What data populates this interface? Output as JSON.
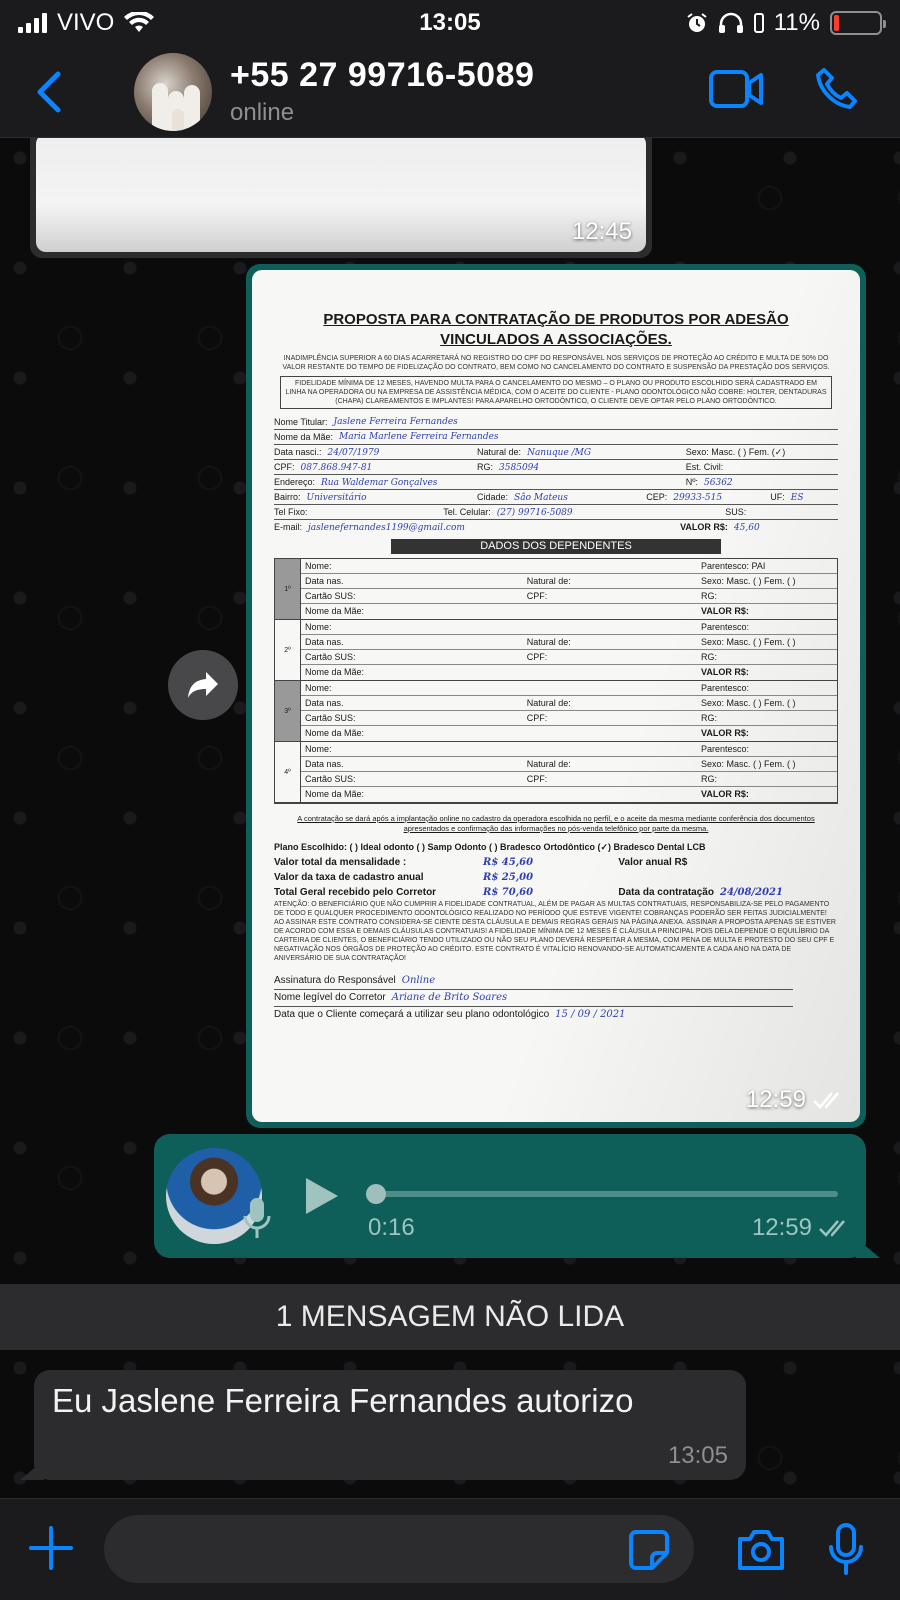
{
  "status_bar": {
    "carrier": "VIVO",
    "time": "13:05",
    "battery_percent": "11%",
    "battery_level": 0.11
  },
  "header": {
    "contact_name": "+55 27 99716-5089",
    "contact_status": "online",
    "icons": {
      "back": "chevron-left-icon",
      "video": "video-camera-icon",
      "call": "phone-icon"
    },
    "accent_color": "#0a84ff"
  },
  "messages": [
    {
      "type": "image",
      "direction": "in",
      "time": "12:45"
    },
    {
      "type": "image",
      "direction": "out",
      "time": "12:59",
      "ticks": "read",
      "document": {
        "title": "PROPOSTA PARA CONTRATAÇÃO DE PRODUTOS POR ADESÃO VINCULADOS A ASSOCIAÇÕES.",
        "notice": "INADIMPLÊNCIA SUPERIOR A 60 DIAS ACARRETARÁ NO REGISTRO DO CPF DO RESPONSÁVEL NOS SERVIÇOS DE PROTEÇÃO AO CRÉDITO E MULTA DE 50% DO VALOR RESTANTE DO TEMPO DE FIDELIZAÇÃO DO CONTRATO, BEM COMO NO CANCELAMENTO DO CONTRATO E SUSPENSÃO DA PRESTAÇÃO DOS SERVIÇOS.",
        "box_text": "FIDELIDADE MÍNIMA DE 12 MESES, HAVENDO MULTA PARA O CANCELAMENTO DO MESMO – O PLANO OU PRODUTO ESCOLHIDO SERÁ CADASTRADO EM LINHA NA OPERADORA OU NA EMPRESA DE ASSISTÊNCIA MÉDICA, COM O ACEITE DO CLIENTE - PLANO ODONTOLÓGICO NÃO COBRE: HOLTER, DENTADURAS (CHAPA) CLAREAMENTOS E IMPLANTES! PARA APARELHO ORTODÔNTICO, O CLIENTE DEVE OPTAR PELO PLANO ORTODÔNTICO.",
        "titular": [
          {
            "label": "Nome Titular:",
            "value": "Jaslene Ferreira Fernandes"
          },
          {
            "label": "Nome da Mãe:",
            "value": "Maria Marlene Ferreira Fernandes"
          },
          {
            "label": "Data nasci.:",
            "value": "24/07/1979",
            "label2": "Natural de:",
            "value2": "Nanuque /MG",
            "label3": "Sexo: Masc. (  ) Fem. (✓)"
          },
          {
            "label": "CPF:",
            "value": "087.868.947-81",
            "label2": "RG:",
            "value2": "3585094",
            "label3": "Est. Civil:"
          },
          {
            "label": "Endereço:",
            "value": "Rua Waldemar Gonçalves",
            "label3": "Nº:",
            "value3": "56362"
          },
          {
            "label": "Bairro:",
            "value": "Universitário",
            "label2": "Cidade:",
            "value2": "São Mateus",
            "label3": "CEP:",
            "value3": "29933-515",
            "label4": "UF:",
            "value4": "ES"
          },
          {
            "label": "Tel Fixo:",
            "label2": "Tel. Celular:",
            "value2": "(27) 99716-5089",
            "label3": "SUS:"
          },
          {
            "label": "E-mail:",
            "value": "jaslenefernandes1199@gmail.com",
            "label3": "VALOR R$:",
            "value3": "45,60"
          }
        ],
        "dependents_header": "DADOS DOS DEPENDENTES",
        "dependents": [
          {
            "num": "1º",
            "parentesco": "Parentesco: PAI"
          },
          {
            "num": "2º",
            "parentesco": "Parentesco:"
          },
          {
            "num": "3º",
            "parentesco": "Parentesco:"
          },
          {
            "num": "4º",
            "parentesco": "Parentesco:"
          }
        ],
        "dep_labels": {
          "nome": "Nome:",
          "data": "Data nas.",
          "natural": "Natural de:",
          "sexo": "Sexo: Masc. (  ) Fem. (  )",
          "cartao": "Cartão SUS:",
          "cpf": "CPF:",
          "rg": "RG:",
          "mae": "Nome da Mãe:",
          "valor": "VALOR R$:"
        },
        "note": "A contratação se dará após a implantação online no cadastro da operadora escolhida no perfil, e o aceite da mesma mediante conferência dos documentos apresentados e confirmação das informações no pós-venda telefônico por parte da mesma.",
        "plano": "Plano Escolhido: ( ) Ideal odonto ( ) Samp Odonto ( ) Bradesco Ortodôntico (✓) Bradesco Dental LCB",
        "valor_total_label": "Valor total da mensalidade :",
        "valor_total": "R$ 45,60",
        "valor_anual_label": "Valor anual R$",
        "taxa_label": "Valor da taxa de cadastro anual",
        "taxa": "R$ 25,00",
        "total_geral_label": "Total Geral recebido pelo Corretor",
        "total_geral": "R$ 70,60",
        "data_contratacao_label": "Data da contratação",
        "data_contratacao": "24/08/2021",
        "atencao": "ATENÇÃO: O BENEFICIÁRIO QUE NÃO CUMPRIR A FIDELIDADE CONTRATUAL, ALÉM DE PAGAR AS MULTAS CONTRATUAIS, RESPONSABILIZA-SE PELO PAGAMENTO DE TODO E QUALQUER PROCEDIMENTO ODONTOLÓGICO REALIZADO NO PERÍODO QUE ESTEVE VIGENTE! COBRANÇAS PODERÃO SER FEITAS JUDICIALMENTE! AO ASSINAR ESTE CONTRATO CONSIDERA-SE CIENTE DESTA CLÁUSULA E DEMAIS REGRAS GERAIS NA PÁGINA ANEXA. ASSINAR A PROPOSTA APENAS SE ESTIVER DE ACORDO COM ESSA E DEMAIS CLÁUSULAS CONTRATUAIS! A FIDELIDADE MÍNIMA DE 12 MESES É CLÁUSULA PRINCIPAL POIS DELA DEPENDE O EQUILÍBRIO DA CARTEIRA DE CLIENTES, O BENEFICIÁRIO TENDO UTILIZADO OU NÃO SEU PLANO DEVERÁ RESPEITAR A MESMA, COM PENA DE MULTA E PROTESTO DO SEU CPF E NEGATIVAÇÃO NOS ÓRGÃOS DE PROTEÇÃO AO CRÉDITO. ESTE CONTRATO É VITALÍCIO RENOVANDO-SE AUTOMATICAMENTE A CADA ANO NA DATA DE ANIVERSÁRIO DE SUA CONTRATAÇÃO!",
        "assinatura_label": "Assinatura do  Responsável",
        "assinatura": "Online",
        "corretor_label": "Nome legível do Corretor",
        "corretor": "Ariane de Brito Soares",
        "inicio_label": "Data que o Cliente começará a utilizar seu plano odontológico",
        "inicio": "15 / 09 / 2021"
      }
    },
    {
      "type": "audio",
      "direction": "out",
      "duration": "0:16",
      "time": "12:59",
      "ticks": "read",
      "progress": 0.0
    },
    {
      "type": "divider",
      "text": "1 MENSAGEM NÃO LIDA"
    },
    {
      "type": "text",
      "direction": "in",
      "text": "Eu Jaslene Ferreira Fernandes autorizo",
      "time": "13:05"
    }
  ],
  "input_bar": {
    "placeholder": "",
    "icons": {
      "add": "plus-icon",
      "sticker": "sticker-icon",
      "camera": "camera-icon",
      "mic": "microphone-icon"
    }
  },
  "colors": {
    "outgoing_bubble": "#0e5f59",
    "incoming_bubble": "#2c2c2e",
    "accent": "#0a84ff",
    "battery_low": "#ff3b30"
  }
}
